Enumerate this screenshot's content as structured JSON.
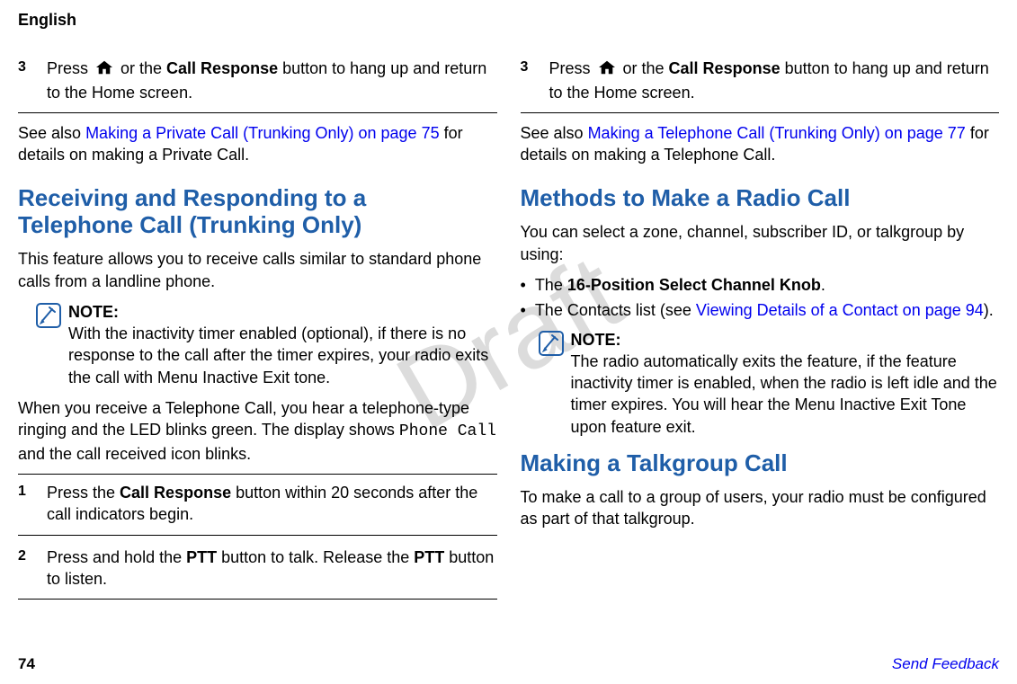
{
  "watermark": "Draft",
  "header": {
    "lang": "English"
  },
  "left": {
    "step3": {
      "num": "3",
      "pre": "Press ",
      "post1": " or the ",
      "bold1": "Call Response",
      "post2": " button to hang up and return to the Home screen."
    },
    "see_also_pre": "See also ",
    "see_also_link": "Making a Private Call (Trunking Only) on page 75",
    "see_also_post": " for details on making a Private Call.",
    "h2a": "Receiving and Responding to a",
    "h2b": "Telephone Call (Trunking Only)",
    "p1": "This feature allows you to receive calls similar to standard phone calls from a landline phone.",
    "note_label": "NOTE:",
    "note_body": "With the inactivity timer enabled (optional), if there is no response to the call after the timer expires, your radio exits the call with Menu Inactive Exit tone.",
    "p2_a": "When you receive a Telephone Call, you hear a telephone-type ringing and the LED blinks green. The display shows ",
    "p2_mono": "Phone Call",
    "p2_b": " and the call received icon blinks.",
    "s1n": "1",
    "s1a": "Press the ",
    "s1b": "Call Response",
    "s1c": " button within 20 seconds after the call indicators begin.",
    "s2n": "2",
    "s2a": "Press and hold the ",
    "s2b": "PTT",
    "s2c": " button to talk. Release the ",
    "s2d": "PTT",
    "s2e": " button to listen."
  },
  "right": {
    "step3": {
      "num": "3",
      "pre": "Press ",
      "post1": " or the ",
      "bold1": "Call Response",
      "post2": " button to hang up and return to the Home screen."
    },
    "see_also_pre": "See also ",
    "see_also_link": "Making a Telephone Call (Trunking Only) on page 77",
    "see_also_post": " for details on making a Telephone Call.",
    "h_methods": "Methods to Make a Radio Call",
    "p_methods": "You can select a zone, channel, subscriber ID, or talkgroup by using:",
    "b1a": "The ",
    "b1b": "16-Position Select Channel Knob",
    "b1c": ".",
    "b2a": "The Contacts list (see ",
    "b2link": "Viewing Details of a Contact on page 94",
    "b2c": ").",
    "note_label": "NOTE:",
    "note_body": "The radio automatically exits the feature, if the feature inactivity timer is enabled, when the radio is left idle and the timer expires. You will hear the Menu Inactive Exit Tone upon feature exit.",
    "h_talk": "Making a Talkgroup Call",
    "p_talk": "To make a call to a group of users, your radio must be configured as part of that talkgroup."
  },
  "footer": {
    "page": "74",
    "feedback": "Send Feedback"
  }
}
